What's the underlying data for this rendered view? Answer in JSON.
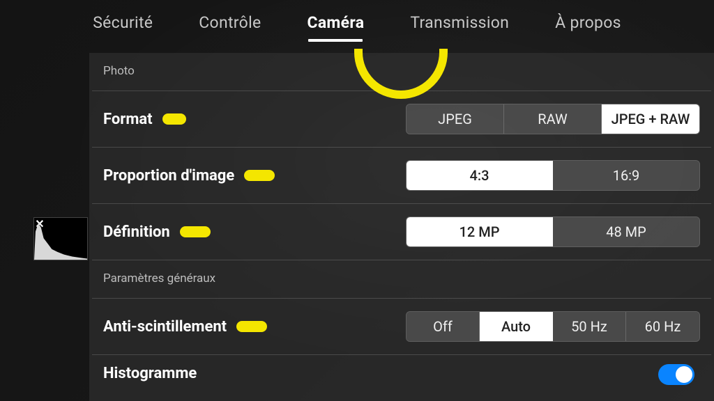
{
  "tabs": {
    "security": "Sécurité",
    "control": "Contrôle",
    "camera": "Caméra",
    "transmission": "Transmission",
    "about": "À propos"
  },
  "sections": {
    "photo": "Photo",
    "general": "Paramètres généraux"
  },
  "rows": {
    "format": {
      "label": "Format",
      "opts": {
        "jpeg": "JPEG",
        "raw": "RAW",
        "jpegraw": "JPEG + RAW"
      },
      "selected": "jpegraw"
    },
    "aspect": {
      "label": "Proportion d'image",
      "opts": {
        "r43": "4:3",
        "r169": "16:9"
      },
      "selected": "r43"
    },
    "definition": {
      "label": "Définition",
      "opts": {
        "mp12": "12 MP",
        "mp48": "48 MP"
      },
      "selected": "mp12"
    },
    "antiflicker": {
      "label": "Anti-scintillement",
      "opts": {
        "off": "Off",
        "auto": "Auto",
        "hz50": "50 Hz",
        "hz60": "60 Hz"
      },
      "selected": "auto"
    },
    "histogram": {
      "label": "Histogramme"
    }
  },
  "colors": {
    "highlighter": "#f4e600",
    "toggle_on": "#0a84ff"
  }
}
